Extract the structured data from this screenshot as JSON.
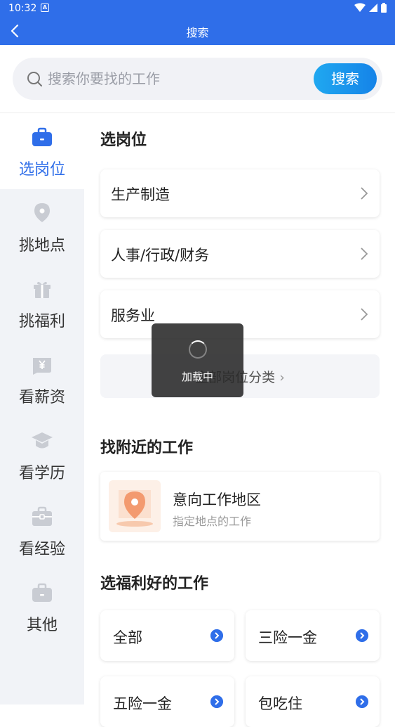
{
  "status": {
    "time": "10:32",
    "app_glyph": "A"
  },
  "header": {
    "title": "搜索"
  },
  "search": {
    "placeholder": "搜索你要找的工作",
    "button_label": "搜索"
  },
  "sidebar": {
    "items": [
      {
        "label": "选岗位",
        "icon": "briefcase-icon",
        "active": true
      },
      {
        "label": "挑地点",
        "icon": "location-pin-icon"
      },
      {
        "label": "挑福利",
        "icon": "gift-icon"
      },
      {
        "label": "看薪资",
        "icon": "yen-icon"
      },
      {
        "label": "看学历",
        "icon": "graduation-cap-icon"
      },
      {
        "label": "看经验",
        "icon": "toolbox-icon"
      },
      {
        "label": "其他",
        "icon": "bag-icon"
      }
    ]
  },
  "main": {
    "section_jobs": "选岗位",
    "job_categories": [
      "生产制造",
      "人事/行政/财务",
      "服务业"
    ],
    "all_categories_label": "全部岗位分类",
    "section_nearby": "找附近的工作",
    "location_card": {
      "title": "意向工作地区",
      "subtitle": "指定地点的工作"
    },
    "section_benefits": "选福利好的工作",
    "benefits": [
      "全部",
      "三险一金",
      "五险一金",
      "包吃住"
    ]
  },
  "toast": {
    "label": "加载中"
  },
  "colors": {
    "accent": "#2f6ee9",
    "search_button": "#1a94ec"
  }
}
